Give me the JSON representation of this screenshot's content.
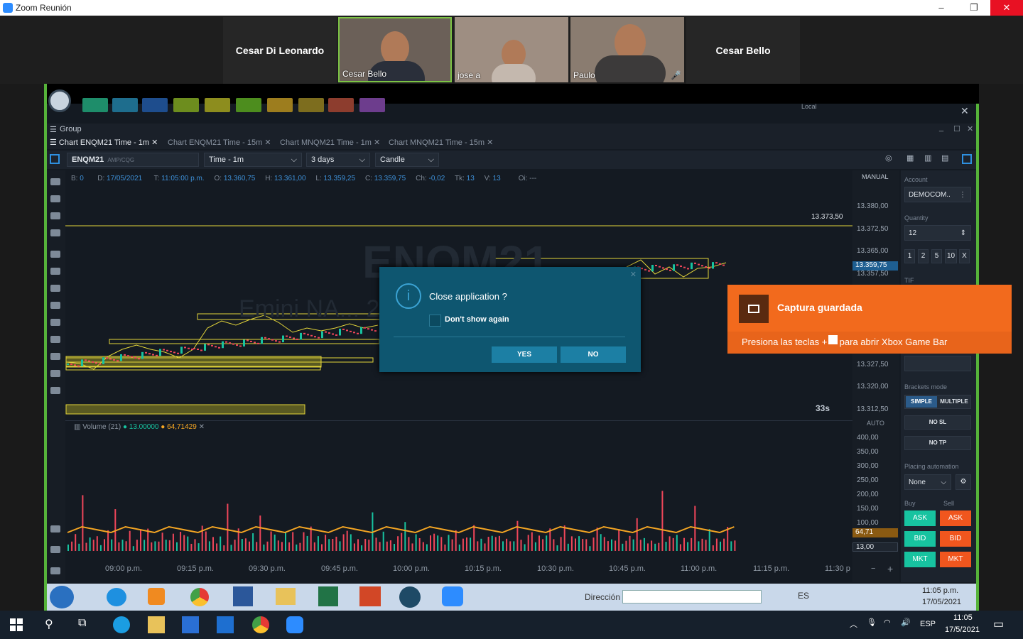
{
  "window": {
    "title": "Zoom Reunión",
    "minimize": "–",
    "maximize": "❐",
    "close": "✕"
  },
  "participants": [
    {
      "name": "Cesar Di Leonardo",
      "type": "name-only"
    },
    {
      "name": "Cesar Bello",
      "type": "video",
      "active": true
    },
    {
      "name": "jose a",
      "type": "video"
    },
    {
      "name": "Paulo",
      "type": "video",
      "muted": true
    },
    {
      "name": "Cesar Bello",
      "type": "name-only"
    }
  ],
  "app": {
    "group_label": "Group",
    "local_label": "Local",
    "tabs": [
      "Chart ENQM21 Time - 1m",
      "Chart ENQM21 Time - 15m",
      "Chart MNQM21 Time - 1m",
      "Chart MNQM21 Time - 15m"
    ],
    "symbol": "ENQM21",
    "exchange": "AMP/CQG",
    "timeframe": "Time - 1m",
    "range": "3 days",
    "chart_type": "Candle",
    "info": {
      "b_label": "B:",
      "b": "0",
      "d_label": "D:",
      "d": "17/05/2021",
      "t_label": "T:",
      "t": "11:05:00 p.m.",
      "o_label": "O:",
      "o": "13.360,75",
      "h_label": "H:",
      "h": "13.361,00",
      "l_label": "L:",
      "l": "13.359,25",
      "c_label": "C:",
      "c": "13.359,75",
      "ch_label": "Ch:",
      "ch": "-0,02",
      "tk_label": "Tk:",
      "tk": "13",
      "v_label": "V:",
      "v": "13",
      "oi_label": "Oi:",
      "oi": "---"
    },
    "watermark": "ENQM21",
    "watermark_sub": "Emini NA... 2021",
    "price_mode": "MANUAL",
    "price_labels": [
      "13.380,00",
      "13.372,50",
      "13.365,00",
      "13.357,50",
      "13.327,50",
      "13.320,00",
      "13.312,50"
    ],
    "level_label": "13.373,50",
    "current_price": "13.359,75",
    "countdown": "33s",
    "volume_legend": "Volume (21)",
    "volume_v1": "13.00000",
    "volume_v2": "64,71429",
    "vol_axis_mode": "AUTO",
    "vol_labels": [
      "400,00",
      "350,00",
      "300,00",
      "250,00",
      "200,00",
      "150,00",
      "100,00"
    ],
    "vol_marker_1": "64,71",
    "vol_marker_2": "13,00",
    "time_labels": [
      "09:00 p.m.",
      "09:15 p.m.",
      "09:30 p.m.",
      "09:45 p.m.",
      "10:00 p.m.",
      "10:15 p.m.",
      "10:30 p.m.",
      "10:45 p.m.",
      "11:00 p.m.",
      "11:15 p.m.",
      "11:30 p"
    ]
  },
  "right_panel": {
    "account_label": "Account",
    "account": "DEMOCOM..",
    "quantity_label": "Quantity",
    "quantity": "12",
    "quick_qty": [
      "1",
      "2",
      "5",
      "10",
      "X"
    ],
    "tif_label": "TIF",
    "brackets_label": "Brackets mode",
    "simple": "SIMPLE",
    "multiple": "MULTIPLE",
    "no_sl": "NO SL",
    "no_tp": "NO TP",
    "placing_label": "Placing automation",
    "placing_value": "None",
    "buy_label": "Buy",
    "sell_label": "Sell",
    "ask": "ASK",
    "bid": "BID",
    "mkt": "MKT"
  },
  "dialog": {
    "title": "Close application ?",
    "checkbox": "Don't show again",
    "yes": "YES",
    "no": "NO",
    "icon": "info-icon"
  },
  "toast": {
    "title": "Captura guardada",
    "body": "Presiona las teclas  + G para abrir Xbox Game Bar"
  },
  "win7bar": {
    "address_label": "Dirección",
    "lang": "ES",
    "time": "11:05 p.m.",
    "date": "17/05/2021"
  },
  "taskbar": {
    "lang": "ESP",
    "time": "11:05",
    "date": "17/5/2021"
  },
  "colors": {
    "bull": "#17c3a0",
    "bear": "#f0465a",
    "zoomGreen": "#56b33a",
    "toast": "#f26a1d",
    "dialog": "#0e5670"
  },
  "chart_data": {
    "type": "bar",
    "series": [
      {
        "values": [
          40,
          35,
          45,
          30,
          160,
          38,
          42,
          60,
          50,
          36,
          44,
          55,
          48,
          120,
          40,
          35,
          52,
          68,
          30,
          42,
          58,
          46,
          64,
          40,
          30,
          50,
          62,
          70,
          40,
          46,
          36,
          55,
          74,
          45,
          38,
          40,
          48,
          94,
          52,
          40
        ]
      }
    ],
    "ylim": [
      0,
      450
    ]
  }
}
